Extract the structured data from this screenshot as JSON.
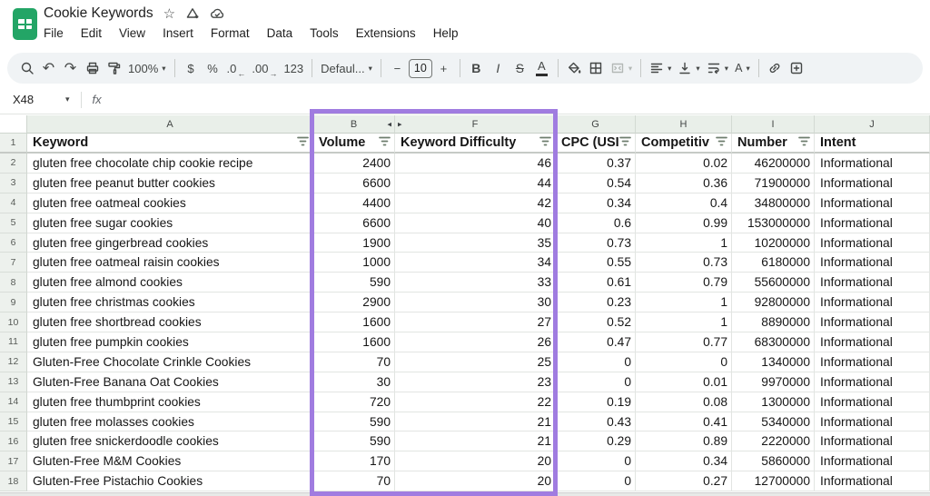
{
  "titlebar": {
    "title": "Cookie Keywords"
  },
  "menubar": {
    "items": [
      "File",
      "Edit",
      "View",
      "Insert",
      "Format",
      "Data",
      "Tools",
      "Extensions",
      "Help"
    ]
  },
  "toolbar": {
    "zoom_level": "100%",
    "currency": "$",
    "percent": "%",
    "decimal_decrease": ".0",
    "decimal_increase": ".00",
    "number_format": "123",
    "font_name": "Defaul...",
    "minus": "−",
    "font_size": "10",
    "plus": "+",
    "bold": "B",
    "italic": "I",
    "strikethrough": "S",
    "text_color": "A",
    "rotate": "A"
  },
  "formula_bar": {
    "cell_reference": "X48",
    "fx_label": "fx"
  },
  "icons": {
    "star": "☆",
    "undo": "↶",
    "redo": "↷",
    "caret": "▾",
    "hidden_left": "◂",
    "hidden_right": "▸",
    "arrow_left": "←",
    "arrow_right": "→"
  },
  "grid": {
    "column_letters": {
      "a": "A",
      "b": "B",
      "f": "F",
      "g": "G",
      "h": "H",
      "i": "I",
      "j": "J"
    },
    "headers": {
      "row_number": "1",
      "keyword": "Keyword",
      "volume": "Volume",
      "kd": "Keyword Difficulty",
      "cpc": "CPC (USI",
      "competition": "Competitiv",
      "number": "Number",
      "intent": "Intent"
    },
    "rows": [
      [
        "2",
        "gluten free chocolate chip cookie recipe",
        "2400",
        "46",
        "0.37",
        "0.02",
        "46200000",
        "Informational"
      ],
      [
        "3",
        "gluten free peanut butter cookies",
        "6600",
        "44",
        "0.54",
        "0.36",
        "71900000",
        "Informational"
      ],
      [
        "4",
        "gluten free oatmeal cookies",
        "4400",
        "42",
        "0.34",
        "0.4",
        "34800000",
        "Informational"
      ],
      [
        "5",
        "gluten free sugar cookies",
        "6600",
        "40",
        "0.6",
        "0.99",
        "153000000",
        "Informational"
      ],
      [
        "6",
        "gluten free gingerbread cookies",
        "1900",
        "35",
        "0.73",
        "1",
        "10200000",
        "Informational"
      ],
      [
        "7",
        "gluten free oatmeal raisin cookies",
        "1000",
        "34",
        "0.55",
        "0.73",
        "6180000",
        "Informational"
      ],
      [
        "8",
        "gluten free almond cookies",
        "590",
        "33",
        "0.61",
        "0.79",
        "55600000",
        "Informational"
      ],
      [
        "9",
        "gluten free christmas cookies",
        "2900",
        "30",
        "0.23",
        "1",
        "92800000",
        "Informational"
      ],
      [
        "10",
        "gluten free shortbread cookies",
        "1600",
        "27",
        "0.52",
        "1",
        "8890000",
        "Informational"
      ],
      [
        "11",
        "gluten free pumpkin cookies",
        "1600",
        "26",
        "0.47",
        "0.77",
        "68300000",
        "Informational"
      ],
      [
        "12",
        "Gluten-Free Chocolate Crinkle Cookies",
        "70",
        "25",
        "0",
        "0",
        "1340000",
        "Informational"
      ],
      [
        "13",
        "Gluten-Free Banana Oat Cookies",
        "30",
        "23",
        "0",
        "0.01",
        "9970000",
        "Informational"
      ],
      [
        "14",
        "gluten free thumbprint cookies",
        "720",
        "22",
        "0.19",
        "0.08",
        "1300000",
        "Informational"
      ],
      [
        "15",
        "gluten free molasses cookies",
        "590",
        "21",
        "0.43",
        "0.41",
        "5340000",
        "Informational"
      ],
      [
        "16",
        "gluten free snickerdoodle cookies",
        "590",
        "21",
        "0.29",
        "0.89",
        "2220000",
        "Informational"
      ],
      [
        "17",
        "Gluten-Free M&M Cookies",
        "170",
        "20",
        "0",
        "0.34",
        "5860000",
        "Informational"
      ],
      [
        "18",
        "Gluten-Free Pistachio Cookies",
        "70",
        "20",
        "0",
        "0.27",
        "12700000",
        "Informational"
      ]
    ]
  },
  "highlight": {
    "color": "#a07ce0"
  }
}
